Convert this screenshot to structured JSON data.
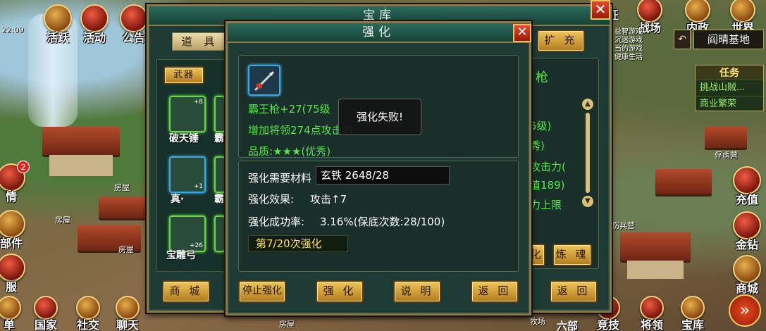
{
  "hud_left": {
    "time": "22:09",
    "items": [
      {
        "label": "活跃"
      },
      {
        "label": "活动"
      },
      {
        "label": "公告"
      }
    ],
    "bottom": [
      {
        "label": "单"
      },
      {
        "label": "国家"
      },
      {
        "label": "社交"
      },
      {
        "label": "聊天"
      }
    ],
    "side": [
      {
        "label": "情",
        "badge": "2"
      },
      {
        "label": "部件"
      },
      {
        "label": "服"
      }
    ],
    "place_tags": [
      "房屋",
      "房屋",
      "房屋",
      "房屋"
    ]
  },
  "hud_right": {
    "top_buttons": [
      {
        "label": "征"
      },
      {
        "label": "战场"
      },
      {
        "label": "内政"
      },
      {
        "label": "世界"
      }
    ],
    "location": "阎晴基地",
    "location_back": "↶",
    "tasks": {
      "title": "任务",
      "items": [
        "挑战山贼...",
        "商业繁荣"
      ]
    },
    "side_buttons": [
      {
        "label": "充值"
      },
      {
        "label": "金钻"
      },
      {
        "label": "商城"
      }
    ],
    "bottom_buttons": [
      {
        "label": "竞技"
      },
      {
        "label": "将领"
      },
      {
        "label": "宝库"
      }
    ],
    "map_labels": [
      "俘虏营",
      "伤兵营",
      "牧场",
      "六部"
    ],
    "notice_lines": [
      "益智游戏",
      "沉迷游戏",
      "当的游戏",
      "健康生活"
    ]
  },
  "treasury_panel": {
    "title": "宝库",
    "close": "✕",
    "tab_label": "道 具",
    "expand_button": "扩 充",
    "weapon_tab": "武器",
    "items": [
      {
        "name": "破天锤",
        "level": "+8"
      },
      {
        "name": "霸",
        "level": ""
      },
      {
        "name": "真·",
        "level": "+1"
      },
      {
        "name": "霸",
        "level": ""
      },
      {
        "name": "宝雕弓",
        "level": "+26"
      },
      {
        "name": "",
        "level": ""
      }
    ],
    "right_text": [
      "枪",
      "5级)",
      "秀)",
      "攻击力(",
      "值189)",
      "力上限"
    ],
    "shop_button": "商 城",
    "refine_button": "炼 魂",
    "back_button": "返 回",
    "partial_button": "化"
  },
  "enhance_panel": {
    "title": "强化",
    "close": "✕",
    "item_title": "霸王枪+27(75级",
    "item_effect": "增加将领274点攻击力",
    "quality_label": "品质:",
    "quality_stars": "★★★",
    "quality_text": "(优秀)",
    "material_label": "强化需要材料",
    "material_value": "玄铁 2648/28",
    "effect_label": "强化效果:",
    "effect_value": "攻击↑7",
    "rate_label": "强化成功率:",
    "rate_value": "3.16%(保底次数:28/100)",
    "count_text": "第7/20次强化",
    "toast": "强化失败!",
    "buttons": {
      "stop": "停止强化",
      "enhance": "强 化",
      "explain": "说 明",
      "back": "返 回"
    }
  }
}
